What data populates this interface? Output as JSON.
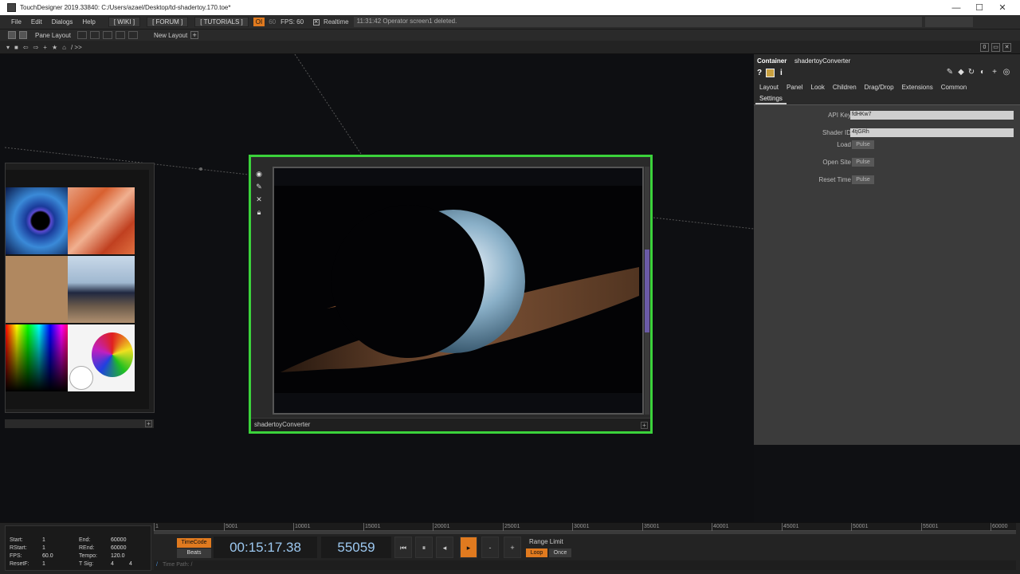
{
  "window": {
    "title": "TouchDesigner 2019.33840: C:/Users/azael/Desktop/td-shadertoy.170.toe*",
    "minimize": "—",
    "maximize": "☐",
    "close": "✕"
  },
  "menubar": {
    "items": [
      "File",
      "Edit",
      "Dialogs",
      "Help"
    ],
    "links": [
      "[ WIKI ]",
      "[ FORUM ]",
      "[ TUTORIALS ]"
    ],
    "oi": "OI",
    "sixty": "60",
    "fps_label": "FPS:  60",
    "realtime_label": "Realtime",
    "status_message": "11:31:42 Operator screen1 deleted."
  },
  "toolbar": {
    "pane_layout": "Pane Layout",
    "new_layout": "New Layout",
    "plus": "+"
  },
  "pathbar": {
    "path": "/  >>",
    "right_zero": "0"
  },
  "main_node": {
    "name": "shadertoyConverter",
    "plus": "+"
  },
  "gallery": {
    "plus": "+"
  },
  "params": {
    "type": "Container",
    "name": "shadertoyConverter",
    "help": "?",
    "info": "i",
    "tabs": [
      "Layout",
      "Panel",
      "Look",
      "Children",
      "Drag/Drop",
      "Extensions",
      "Common"
    ],
    "subtab": "Settings",
    "rows": {
      "api_key_label": "API Key",
      "api_key_value": "fdHKw7",
      "shader_id_label": "Shader ID",
      "shader_id_value": "4tjGRh",
      "load_label": "Load",
      "open_site_label": "Open Site",
      "reset_time_label": "Reset Time",
      "pulse": "Pulse"
    }
  },
  "timeline": {
    "range": {
      "start_label": "Start:",
      "start": "1",
      "end_label": "End:",
      "end": "60000",
      "rstart_label": "RStart:",
      "rstart": "1",
      "rend_label": "REnd:",
      "rend": "60000",
      "fps_label": "FPS:",
      "fps": "60.0",
      "tempo_label": "Tempo:",
      "tempo": "120.0",
      "resetf_label": "ResetF:",
      "resetf": "1",
      "tsig_label": "T Sig:",
      "tsig_a": "4",
      "tsig_b": "4"
    },
    "ticks": [
      "1",
      "5001",
      "10001",
      "15001",
      "20001",
      "25001",
      "30001",
      "35001",
      "40001",
      "45001",
      "50001",
      "55001",
      "60000"
    ],
    "timecode_btn": "TimeCode",
    "beats_btn": "Beats",
    "timecode": "00:15:17.38",
    "frame": "55059",
    "transport": [
      "⏮",
      "⏸",
      "◂",
      "▸",
      "-",
      "+"
    ],
    "range_limit": "Range Limit",
    "loop": "Loop",
    "once": "Once",
    "time_path": "Time Path: /",
    "time_path_slash": "/"
  }
}
